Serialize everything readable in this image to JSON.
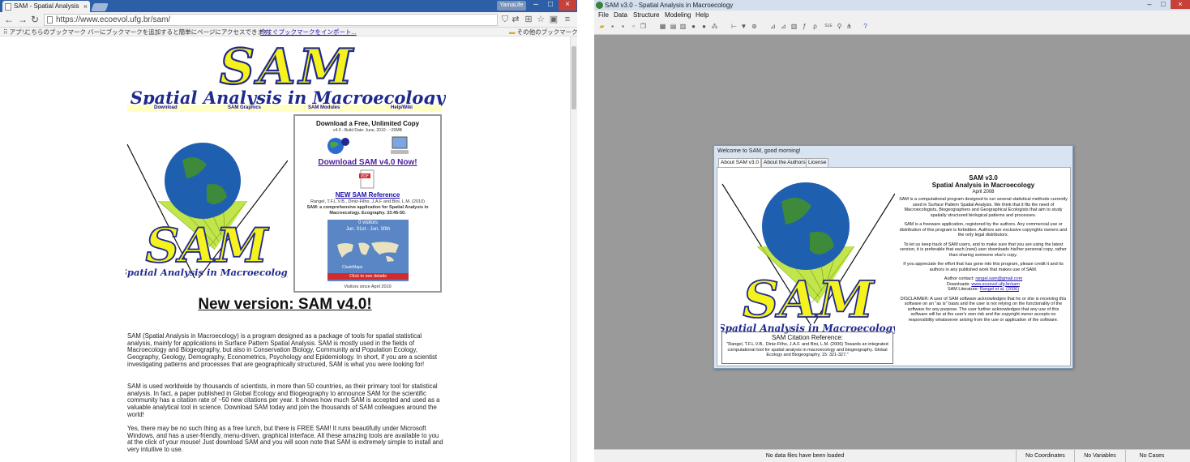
{
  "browser": {
    "tab_title": "SAM - Spatial Analysis",
    "profile": "YamaLife",
    "url": "https://www.ecoevol.ufg.br/sam/",
    "bookmarks": {
      "apps": "アプリ",
      "message": "こちらのブックマーク バーにブックマークを追加すると簡単にページにアクセスできます。",
      "import": "今すぐブックマークをインポート...",
      "other": "その他のブックマーク"
    }
  },
  "page": {
    "logo_big": "SAM",
    "logo_sub": "Spatial Analysis in Macroecology",
    "nav": [
      "Download",
      "SAM Graphics",
      "SAM Modules",
      "Help/Wiki"
    ],
    "download_box": {
      "heading": "Download a Free, Unlimited Copy",
      "subheading": "v4.0 - Build Date: June, 2010 - ~20MB",
      "download_link": "Download SAM v4.0 Now!",
      "ref_link": "NEW SAM Reference",
      "ref_authors": "Rangel, T.F.L.V.B., Diniz-Filho, J.A.F and Bini, L.M. (2010)",
      "ref_title": "SAM: a comprehensive application for Spatial Analysis in Macroecology. Ecography. 33:46-50.",
      "visitors_count": "0 visitors",
      "visitors_range": "Jun. 01st - Jun. 30th",
      "map_label": "ClustrMaps",
      "visitors_button": "Click to see details",
      "visitors_since": "Visitors since April 2010"
    },
    "headline": "New version: SAM v4.0!",
    "paragraph1": "SAM (Spatial Analysis in Macroecology) is a program designed as a package of tools for spatial statistical analysis, mainly for applications in Surface Pattern Spatial Analysis. SAM is mostly used in the fields of Macroecology and Biogeography, but also in Conservation Biology, Community and Population Ecology, Geography, Geology, Demography, Econometrics, Psychology and Epidemiology. In short, if you are a scientist investigating patterns and processes that are geographically structured, SAM is what you were looking for!",
    "paragraph2": "SAM is used worldwide by thousands of scientists, in more than 50 countries, as their primary tool for statistical analysis. In fact, a paper published in Global Ecology and Biogeography to announce SAM for the scientific community has a citation rate of ~50 new citations per year. It shows how much SAM is accepted and used as a valuable analytical tool in science. Download SAM today and join the thousands of SAM colleagues around the world!",
    "paragraph3": "Yes, there may be no such thing as a free lunch, but there is FREE SAM! It runs beautifully under Microsoft Windows, and has a user-friendly, menu-driven, graphical interface. All these amazing tools are available to you at the click of your mouse! Just download SAM and you will soon note that SAM is extremely simple to install and very intuitive to use."
  },
  "app": {
    "title": "SAM v3.0 - Spatial Analysis in Macroecology",
    "menu": [
      "File",
      "Data",
      "Structure",
      "Modeling",
      "Help"
    ],
    "status": {
      "message": "No data files have been loaded",
      "coords": "No Coordinates",
      "variables": "No Variables",
      "cases": "No Cases"
    },
    "dialog": {
      "title": "Welcome to SAM, good morning!",
      "tabs": [
        "About SAM v3.0",
        "About the Authors",
        "License"
      ],
      "version": "SAM v3.0",
      "subtitle": "Spatial Analysis in Macroecology",
      "date": "April 2008",
      "p1": "SAM is a computational program designed to run several statistical methods currently used in Surface Pattern Spatial Analysis. We think that it fits the need of Macroecologists, Biogeographers and Geographical Ecologists that aim to study spatially structured biological patterns and processes.",
      "p2": "SAM is a freeware application, registered by the authors. Any commercial use or distribution of this program is forbidden. Authors are exclusive copyrights owners and the only legal distributors.",
      "p3": "To let us keep track of SAM users, and to make sure that you are using the latest version, it is preferable that each (new) user downloads his/her personal copy, rather than sharing someone else's copy.",
      "p4": "If you appreciate the effort that has gone into this program, please credit it and its authors in any published work that makes use of SAM.",
      "contact_label": "Author contact:",
      "contact": "rangel.sam@gmail.com",
      "downloads_label": "Downloads:",
      "downloads": "www.ecoevol.ufg.br/sam",
      "literature_label": "SAM Literature:",
      "literature": "Rangel et al. (2006)",
      "disclaimer": "DISCLAIMER: A user of SAM software acknowledges that he or she is receiving this software on an \"as is\" basis and the user is not relying on the functionality of the software for any purpose. The user further acknowledges that any use of this software will be at the user's own risk and the copyright owner accepts no responsibility whatsoever arising from the use or application of the software.",
      "cite_title": "SAM Citation Reference:",
      "cite_body": "\"Rangel, T.F.L.V.B., Diniz-Filho, J.A.F. and Bini, L.M. (2006) Towards an integrated computational tool for spatial analysis in macroecology and biogeography. Global Ecology and Biogeography, 15: 321-327.\"",
      "logo_big": "SAM",
      "logo_sub": "Spatial Analysis in Macroecology"
    }
  },
  "colors": {
    "logo_yellow": "#f5f21e",
    "logo_blue": "#1f2a8c",
    "tabstrip": "#2c5fa8",
    "app_bg": "#9a9a9a"
  }
}
